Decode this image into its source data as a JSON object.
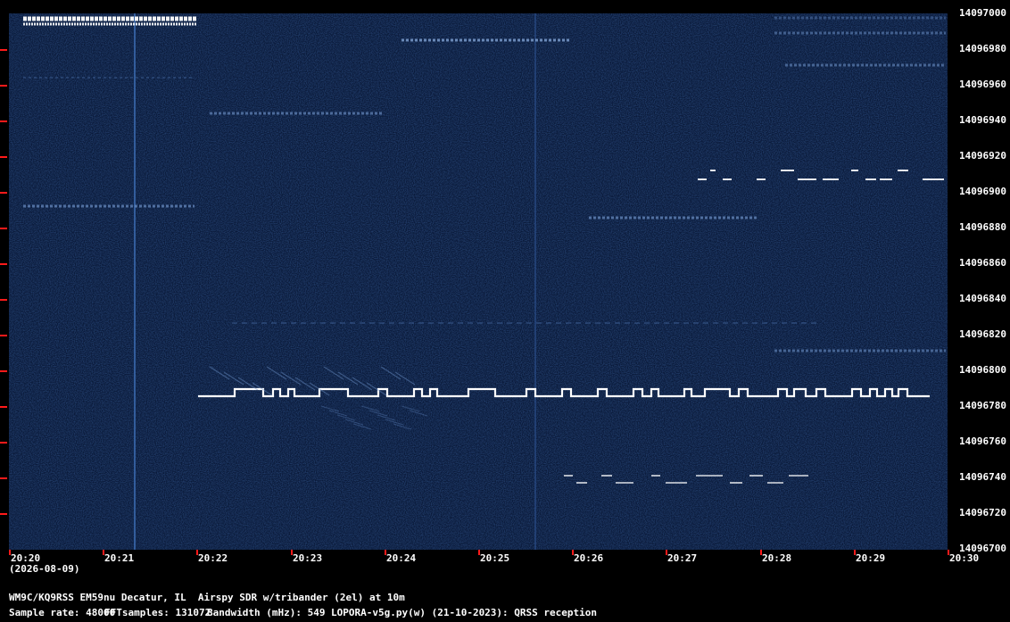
{
  "colors": {
    "background": "#000000",
    "waterfall_bg": "#0a1a3a",
    "signal": "#ffffff",
    "tick_red": "#ff1a1a",
    "text": "#ffffff"
  },
  "y_axis": {
    "labels": [
      "14097000",
      "14096980",
      "14096960",
      "14096940",
      "14096920",
      "14096900",
      "14096880",
      "14096860",
      "14096840",
      "14096820",
      "14096800",
      "14096780",
      "14096760",
      "14096740",
      "14096720",
      "14096700"
    ],
    "min_hz": 14096700,
    "max_hz": 14097000
  },
  "x_axis": {
    "labels": [
      "20:20",
      "20:21",
      "20:22",
      "20:23",
      "20:24",
      "20:25",
      "20:26",
      "20:27",
      "20:28",
      "20:29",
      "20:30"
    ],
    "date": "(2026-08-09)"
  },
  "footer": {
    "station": "WM9C/KQ9RSS EM59nu Decatur, IL  Airspy SDR w/tribander (2el) at 10m",
    "sample_rate": "Sample rate: 48000",
    "fft_samples": "FFTsamples: 131072",
    "bandwidth": "Bandwidth (mHz): 549",
    "software": "LOPORA-v5g.py(w) (21-10-2023): QRSS reception"
  }
}
